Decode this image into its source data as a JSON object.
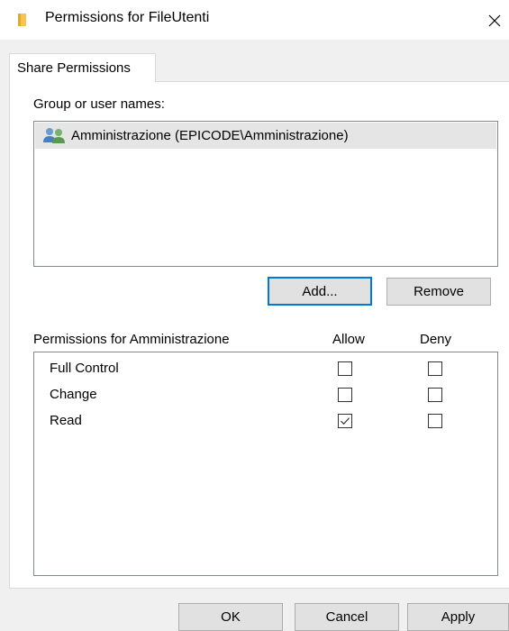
{
  "window": {
    "title": "Permissions for FileUtenti",
    "icon": "folder-icon",
    "close_icon": "close-icon"
  },
  "tabs": [
    {
      "label": "Share Permissions",
      "selected": true
    }
  ],
  "group_section": {
    "label": "Group or user names:",
    "users": [
      {
        "name": "Amministrazione (EPICODE\\Amministrazione)",
        "icon": "user-group-icon",
        "selected": true
      }
    ],
    "add_label": "Add...",
    "remove_label": "Remove"
  },
  "permissions_section": {
    "label": "Permissions for Amministrazione",
    "allow_header": "Allow",
    "deny_header": "Deny",
    "rows": [
      {
        "name": "Full Control",
        "allow": false,
        "deny": false
      },
      {
        "name": "Change",
        "allow": false,
        "deny": false
      },
      {
        "name": "Read",
        "allow": true,
        "deny": false
      }
    ]
  },
  "footer": {
    "ok_label": "OK",
    "cancel_label": "Cancel",
    "apply_label": "Apply"
  },
  "colors": {
    "accent": "#0078d7",
    "folder": "#f7c64e",
    "selection": "#e5e5e5"
  }
}
